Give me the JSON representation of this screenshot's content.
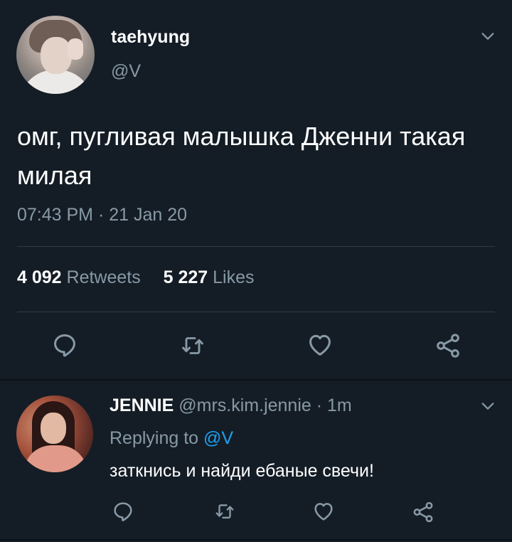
{
  "tweet": {
    "author_name": "taehyung",
    "author_handle": "@V",
    "text": "омг, пугливая малышка Дженни такая милая",
    "timestamp": "07:43 PM · 21 Jan 20",
    "retweets_count": "4 092",
    "retweets_label": "Retweets",
    "likes_count": "5 227",
    "likes_label": "Likes",
    "actions": [
      "reply-icon",
      "retweet-icon",
      "like-icon",
      "share-icon"
    ]
  },
  "reply": {
    "author_name": "JENNIE",
    "author_handle": "@mrs.kim.jennie",
    "separator": " · ",
    "time": "1m",
    "replying_label": "Replying to ",
    "replying_to": "@V",
    "text": "заткнись и найди ебаные свечи!",
    "actions": [
      "reply-icon",
      "retweet-icon",
      "like-icon",
      "share-icon"
    ]
  },
  "colors": {
    "background": "#141d26",
    "text_primary": "#ffffff",
    "text_secondary": "#8899a6",
    "link": "#1da1f2",
    "divider": "#2f3b47"
  }
}
